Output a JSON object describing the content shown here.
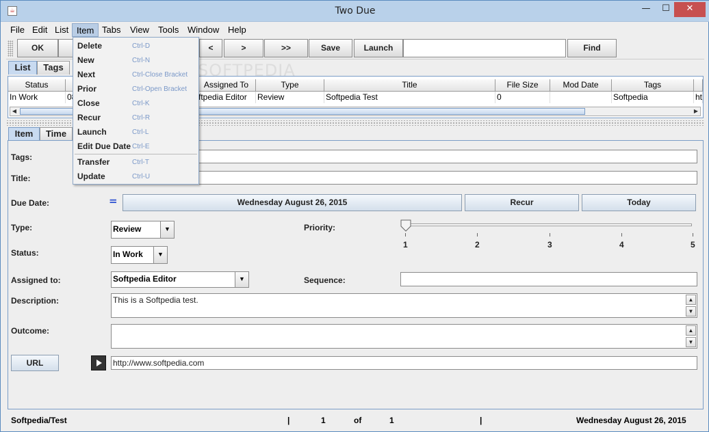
{
  "window": {
    "title": "Two Due"
  },
  "menubar": [
    "File",
    "Edit",
    "List",
    "Item",
    "Tabs",
    "View",
    "Tools",
    "Window",
    "Help"
  ],
  "toolbar": {
    "ok": "OK",
    "prev": "<",
    "next": ">",
    "last": ">>",
    "save": "Save",
    "launch": "Launch",
    "find": "Find",
    "search_value": ""
  },
  "top_tabs": [
    "List",
    "Tags"
  ],
  "table": {
    "columns": [
      "Status",
      "",
      "",
      "Assigned To",
      "Type",
      "Title",
      "File Size",
      "Mod Date",
      "Tags",
      ""
    ],
    "row": [
      "In Work",
      "08",
      "",
      "ftpedia Editor",
      "Review",
      "Softpedia Test",
      "0",
      "",
      "Softpedia",
      "ht"
    ]
  },
  "item_tabs": [
    "Item",
    "Time"
  ],
  "form": {
    "tags_label": "Tags:",
    "tags_value": "",
    "title_label": "Title:",
    "title_value": "",
    "due_label": "Due Date:",
    "due_marker": "=",
    "due_value": "Wednesday  August 26, 2015",
    "recur_button": "Recur",
    "today_button": "Today",
    "type_label": "Type:",
    "type_value": "Review",
    "priority_label": "Priority:",
    "priority_ticks": [
      "1",
      "2",
      "3",
      "4",
      "5"
    ],
    "priority_value": 1,
    "status_label": "Status:",
    "status_value": "In Work",
    "assigned_label": "Assigned to:",
    "assigned_value": "Softpedia Editor",
    "sequence_label": "Sequence:",
    "sequence_value": "",
    "description_label": "Description:",
    "description_value": "This is a Softpedia test.",
    "outcome_label": "Outcome:",
    "outcome_value": "",
    "url_button": "URL",
    "url_value": "http://www.softpedia.com"
  },
  "statusbar": {
    "path": "Softpedia/Test",
    "sep1": "|",
    "current": "1",
    "of": "of",
    "total": "1",
    "sep2": "|",
    "date": "Wednesday August 26, 2015"
  },
  "item_menu": [
    {
      "label": "Delete",
      "accel": "Ctrl-D"
    },
    {
      "label": "New",
      "accel": "Ctrl-N"
    },
    {
      "label": "Next",
      "accel": "Ctrl-Close Bracket"
    },
    {
      "label": "Prior",
      "accel": "Ctrl-Open Bracket"
    },
    {
      "label": "Close",
      "accel": "Ctrl-K"
    },
    {
      "label": "Recur",
      "accel": "Ctrl-R"
    },
    {
      "label": "Launch",
      "accel": "Ctrl-L"
    },
    {
      "label": "Edit Due Date",
      "accel": "Ctrl-E"
    },
    {
      "label": "Transfer",
      "accel": "Ctrl-T"
    },
    {
      "label": "Update",
      "accel": "Ctrl-U"
    }
  ],
  "watermark": "SOFTPEDIA",
  "colors": {
    "title_bar": "#b9d1ea",
    "tab_selected": "#c8daf0",
    "close_button": "#c75050",
    "accent_text": "#7a98c8"
  }
}
